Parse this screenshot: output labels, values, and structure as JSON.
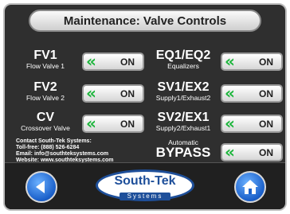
{
  "title": "Maintenance: Valve Controls",
  "valves_left": [
    {
      "name": "FV1",
      "desc": "Flow Valve 1",
      "state": "ON"
    },
    {
      "name": "FV2",
      "desc": "Flow Valve 2",
      "state": "ON"
    },
    {
      "name": "CV",
      "desc": "Crossover Valve",
      "state": "ON"
    }
  ],
  "valves_right": [
    {
      "name": "EQ1/EQ2",
      "desc": "Equalizers",
      "state": "ON"
    },
    {
      "name": "SV1/EX2",
      "desc": "Supply1/Exhaust2",
      "state": "ON"
    },
    {
      "name": "SV2/EX1",
      "desc": "Supply2/Exhaust1",
      "state": "ON"
    }
  ],
  "bypass": {
    "pre": "Automatic",
    "name": "BYPASS",
    "state": "ON"
  },
  "toggle_icon": "double-chevron-left-icon",
  "contact": {
    "line1": "Contact South-Tek Systems:",
    "line2": "Toll-free: (888) 526-6284",
    "line3": "Email: info@southteksystems.com",
    "line4": "Website: www.southteksystems.com"
  },
  "logo": {
    "brand": "South-Tek",
    "tagline": "Systems"
  },
  "nav": {
    "back_icon": "back-arrow-icon",
    "home_icon": "home-icon"
  },
  "colors": {
    "chevron": "#1bb53a",
    "nav_blue": "#1a5fc9",
    "background": "#2f2f2f",
    "logo_blue": "#1e4f9a"
  }
}
